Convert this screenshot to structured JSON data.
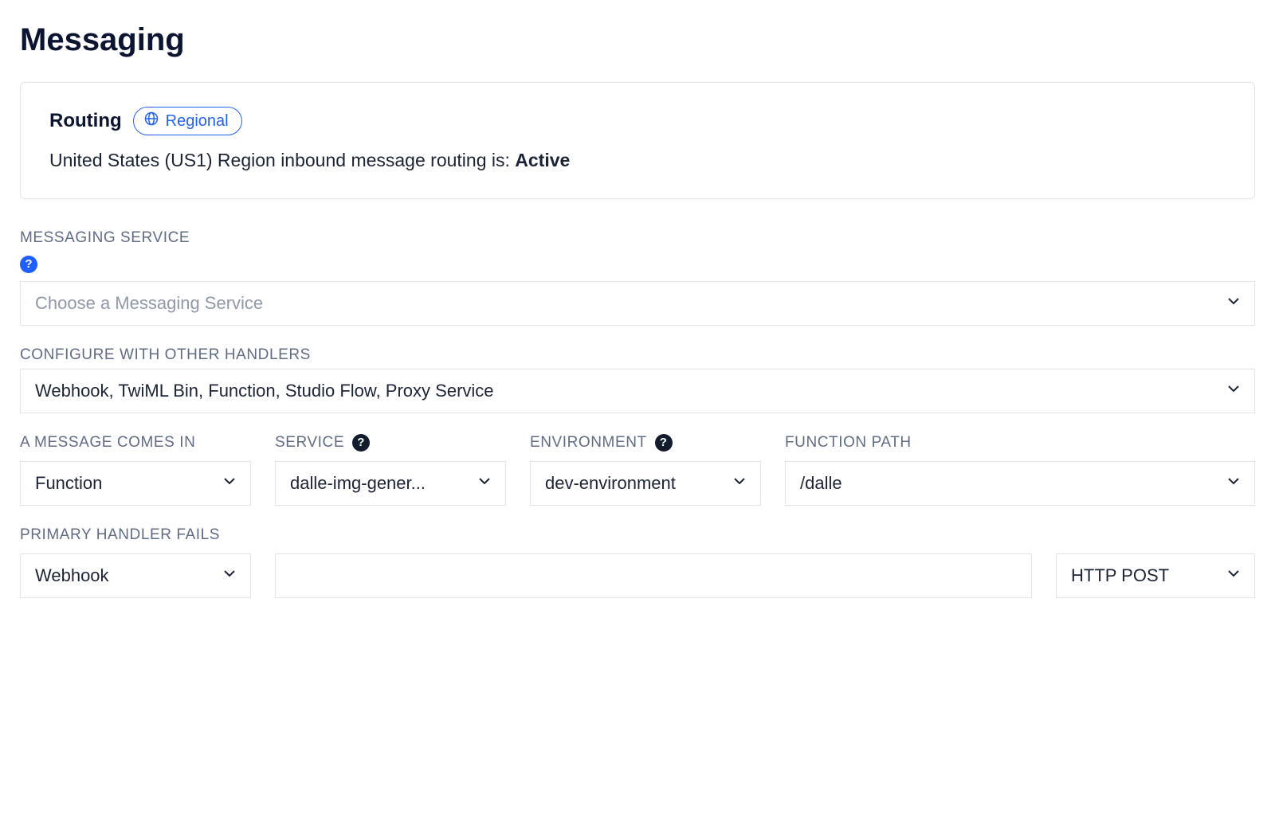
{
  "page": {
    "title": "Messaging"
  },
  "routing": {
    "heading": "Routing",
    "pill_label": "Regional",
    "status_prefix": "United States (US1) Region inbound message routing is: ",
    "status_value": "Active"
  },
  "messaging_service": {
    "label": "MESSAGING SERVICE",
    "placeholder": "Choose a Messaging Service",
    "value": ""
  },
  "configure_handlers": {
    "label": "CONFIGURE WITH OTHER HANDLERS",
    "value": "Webhook, TwiML Bin, Function, Studio Flow, Proxy Service"
  },
  "incoming": {
    "message_comes_in": {
      "label": "A MESSAGE COMES IN",
      "value": "Function"
    },
    "service": {
      "label": "SERVICE",
      "value": "dalle-img-gener..."
    },
    "environment": {
      "label": "ENVIRONMENT",
      "value": "dev-environment"
    },
    "function_path": {
      "label": "FUNCTION PATH",
      "value": "/dalle"
    }
  },
  "primary_handler_fails": {
    "label": "PRIMARY HANDLER FAILS",
    "type_value": "Webhook",
    "url_value": "",
    "method_value": "HTTP POST"
  },
  "icons": {
    "help": "?",
    "globe": "globe-icon",
    "chevron": "chevron-down-icon"
  }
}
